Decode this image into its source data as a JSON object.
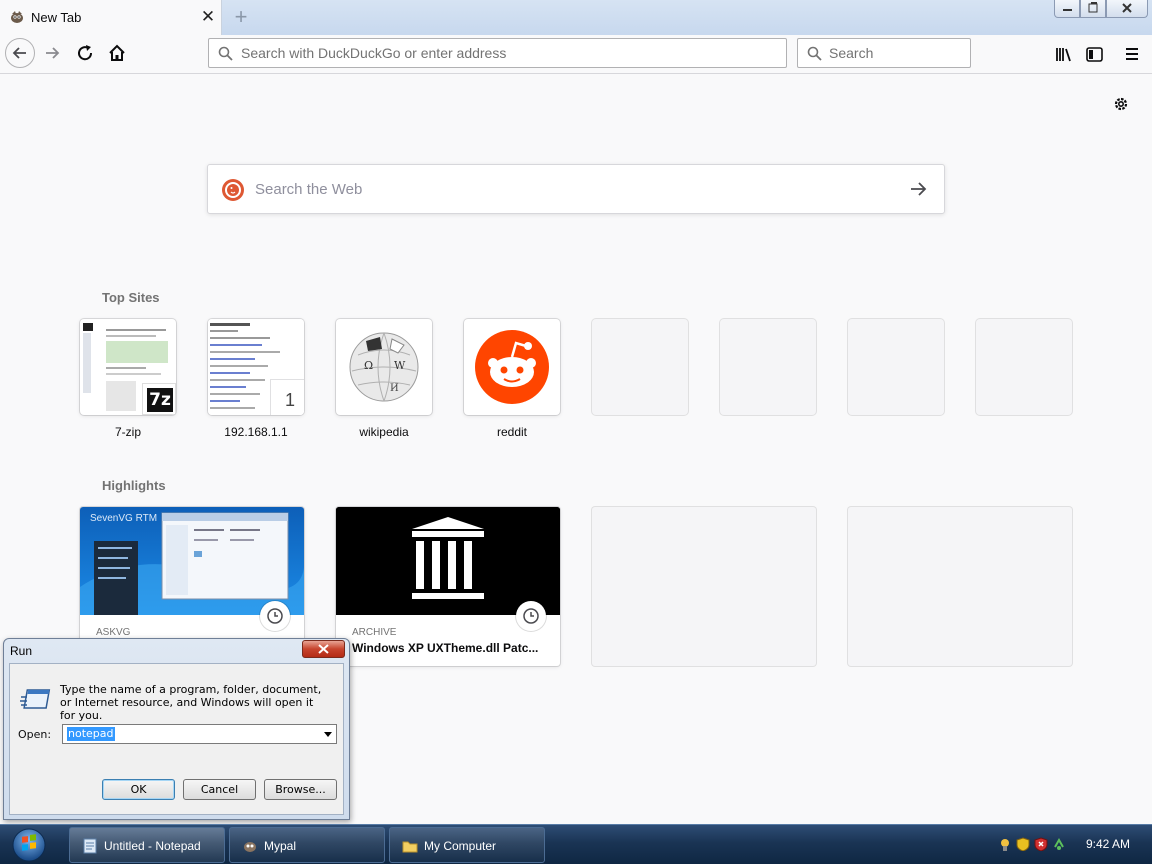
{
  "browser": {
    "tab_title": "New Tab",
    "tab_close_glyph": "✕",
    "new_tab_glyph": "+",
    "url_placeholder": "Search with DuckDuckGo or enter address",
    "search_placeholder": "Search",
    "icons": [
      "back-icon",
      "forward-icon",
      "reload-icon",
      "home-icon",
      "library-icon",
      "sidebar-icon",
      "menu-icon",
      "search-icon"
    ]
  },
  "newtab": {
    "web_search_placeholder": "Search the Web",
    "topsites_title": "Top Sites",
    "highlights_title": "Highlights",
    "top_sites": [
      {
        "label": "7-zip",
        "badge": "7z"
      },
      {
        "label": "192.168.1.1",
        "badge": "1"
      },
      {
        "label": "wikipedia"
      },
      {
        "label": "reddit"
      }
    ],
    "highlights": [
      {
        "source": "ASKVG",
        "title": "",
        "image_caption": "SevenVG RTM"
      },
      {
        "source": "ARCHIVE",
        "title": "Windows XP UXTheme.dll Patc..."
      }
    ]
  },
  "run_dialog": {
    "title": "Run",
    "description": "Type the name of a program, folder, document, or Internet resource, and Windows will open it for you.",
    "open_label": "Open:",
    "open_value": "notepad",
    "ok_label": "OK",
    "cancel_label": "Cancel",
    "browse_label": "Browse..."
  },
  "taskbar": {
    "tasks": [
      {
        "label": "Untitled - Notepad"
      },
      {
        "label": "Mypal"
      },
      {
        "label": "My Computer"
      }
    ],
    "clock": "9:42 AM"
  },
  "colors": {
    "reddit": "#ff4500",
    "ddg": "#de5833",
    "archive_bg": "#000000",
    "taskbar": "#1a3454"
  }
}
